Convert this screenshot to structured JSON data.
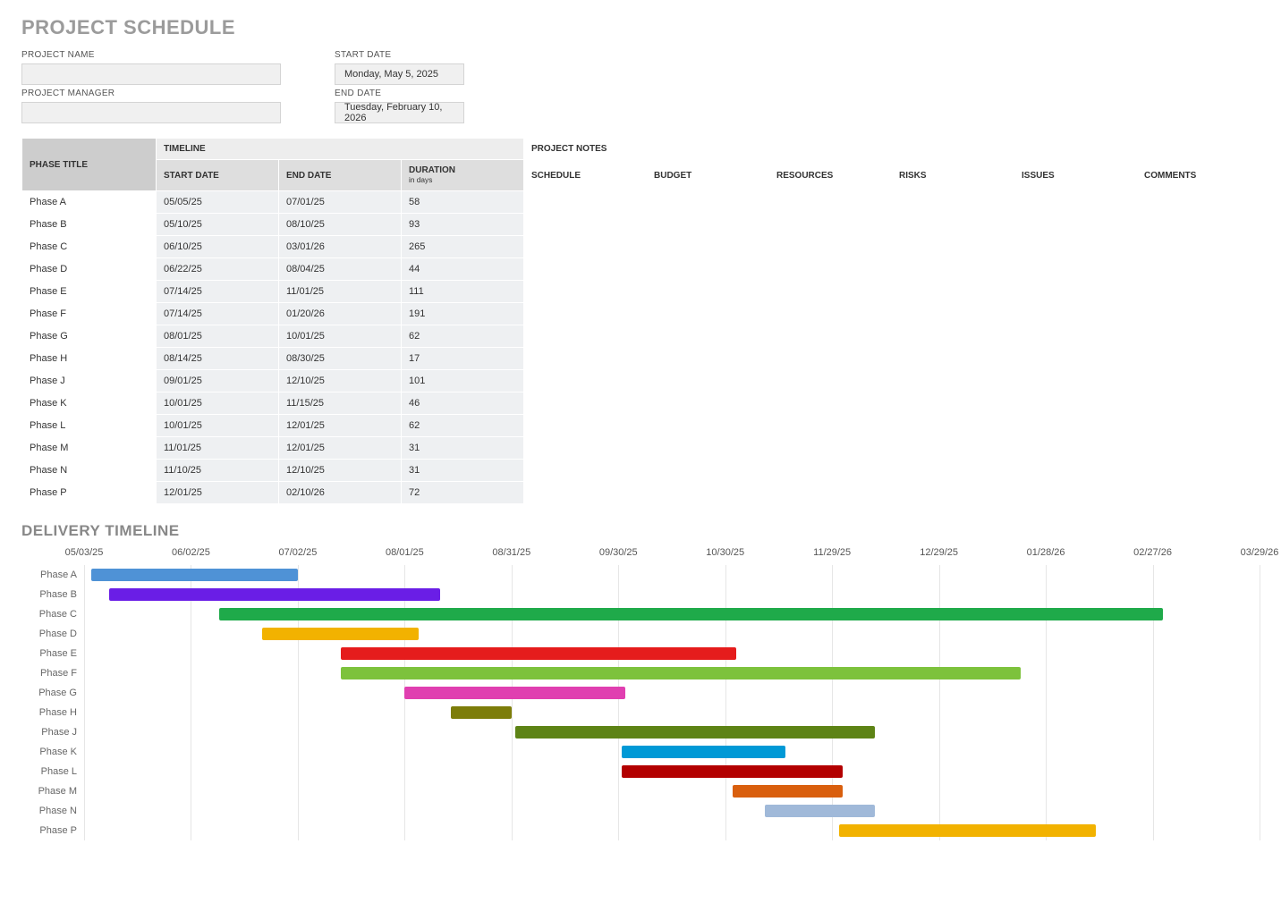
{
  "title": "PROJECT SCHEDULE",
  "header": {
    "project_name_label": "PROJECT NAME",
    "project_name_value": "",
    "project_manager_label": "PROJECT MANAGER",
    "project_manager_value": "",
    "start_date_label": "START DATE",
    "start_date_value": "Monday, May 5, 2025",
    "end_date_label": "END DATE",
    "end_date_value": "Tuesday, February 10, 2026"
  },
  "table": {
    "headers": {
      "phase_title": "PHASE TITLE",
      "timeline": "TIMELINE",
      "project_notes": "PROJECT NOTES",
      "start_date": "START DATE",
      "end_date": "END DATE",
      "duration": "DURATION",
      "duration_sub": "in days",
      "schedule": "SCHEDULE",
      "budget": "BUDGET",
      "resources": "RESOURCES",
      "risks": "RISKS",
      "issues": "ISSUES",
      "comments": "COMMENTS"
    },
    "rows": [
      {
        "title": "Phase A",
        "start": "05/05/25",
        "end": "07/01/25",
        "duration": 58,
        "schedule": "",
        "budget": "",
        "resources": "",
        "risks": "",
        "issues": "",
        "comments": ""
      },
      {
        "title": "Phase B",
        "start": "05/10/25",
        "end": "08/10/25",
        "duration": 93,
        "schedule": "",
        "budget": "",
        "resources": "",
        "risks": "",
        "issues": "",
        "comments": ""
      },
      {
        "title": "Phase C",
        "start": "06/10/25",
        "end": "03/01/26",
        "duration": 265,
        "schedule": "",
        "budget": "",
        "resources": "",
        "risks": "",
        "issues": "",
        "comments": ""
      },
      {
        "title": "Phase D",
        "start": "06/22/25",
        "end": "08/04/25",
        "duration": 44,
        "schedule": "",
        "budget": "",
        "resources": "",
        "risks": "",
        "issues": "",
        "comments": ""
      },
      {
        "title": "Phase E",
        "start": "07/14/25",
        "end": "11/01/25",
        "duration": 111,
        "schedule": "",
        "budget": "",
        "resources": "",
        "risks": "",
        "issues": "",
        "comments": ""
      },
      {
        "title": "Phase F",
        "start": "07/14/25",
        "end": "01/20/26",
        "duration": 191,
        "schedule": "",
        "budget": "",
        "resources": "",
        "risks": "",
        "issues": "",
        "comments": ""
      },
      {
        "title": "Phase G",
        "start": "08/01/25",
        "end": "10/01/25",
        "duration": 62,
        "schedule": "",
        "budget": "",
        "resources": "",
        "risks": "",
        "issues": "",
        "comments": ""
      },
      {
        "title": "Phase H",
        "start": "08/14/25",
        "end": "08/30/25",
        "duration": 17,
        "schedule": "",
        "budget": "",
        "resources": "",
        "risks": "",
        "issues": "",
        "comments": ""
      },
      {
        "title": "Phase J",
        "start": "09/01/25",
        "end": "12/10/25",
        "duration": 101,
        "schedule": "",
        "budget": "",
        "resources": "",
        "risks": "",
        "issues": "",
        "comments": ""
      },
      {
        "title": "Phase K",
        "start": "10/01/25",
        "end": "11/15/25",
        "duration": 46,
        "schedule": "",
        "budget": "",
        "resources": "",
        "risks": "",
        "issues": "",
        "comments": ""
      },
      {
        "title": "Phase L",
        "start": "10/01/25",
        "end": "12/01/25",
        "duration": 62,
        "schedule": "",
        "budget": "",
        "resources": "",
        "risks": "",
        "issues": "",
        "comments": ""
      },
      {
        "title": "Phase M",
        "start": "11/01/25",
        "end": "12/01/25",
        "duration": 31,
        "schedule": "",
        "budget": "",
        "resources": "",
        "risks": "",
        "issues": "",
        "comments": ""
      },
      {
        "title": "Phase N",
        "start": "11/10/25",
        "end": "12/10/25",
        "duration": 31,
        "schedule": "",
        "budget": "",
        "resources": "",
        "risks": "",
        "issues": "",
        "comments": ""
      },
      {
        "title": "Phase P",
        "start": "12/01/25",
        "end": "02/10/26",
        "duration": 72,
        "schedule": "",
        "budget": "",
        "resources": "",
        "risks": "",
        "issues": "",
        "comments": ""
      }
    ]
  },
  "timeline_title": "DELIVERY TIMELINE",
  "chart_data": {
    "type": "bar",
    "orientation": "horizontal-gantt",
    "x_ticks": [
      "05/03/25",
      "06/02/25",
      "07/02/25",
      "08/01/25",
      "08/31/25",
      "09/30/25",
      "10/30/25",
      "11/29/25",
      "12/29/25",
      "01/28/26",
      "02/27/26",
      "03/29/26"
    ],
    "x_range_days": {
      "start": "05/03/25",
      "span_days": 330
    },
    "series": [
      {
        "name": "Phase A",
        "start": "05/05/25",
        "duration_days": 58,
        "color": "#4f92d6"
      },
      {
        "name": "Phase B",
        "start": "05/10/25",
        "duration_days": 93,
        "color": "#6a1ee6"
      },
      {
        "name": "Phase C",
        "start": "06/10/25",
        "duration_days": 265,
        "color": "#1faa4a"
      },
      {
        "name": "Phase D",
        "start": "06/22/25",
        "duration_days": 44,
        "color": "#f2b200"
      },
      {
        "name": "Phase E",
        "start": "07/14/25",
        "duration_days": 111,
        "color": "#e51c1c"
      },
      {
        "name": "Phase F",
        "start": "07/14/25",
        "duration_days": 191,
        "color": "#7dc23c"
      },
      {
        "name": "Phase G",
        "start": "08/01/25",
        "duration_days": 62,
        "color": "#e03fb0"
      },
      {
        "name": "Phase H",
        "start": "08/14/25",
        "duration_days": 17,
        "color": "#7d7d0a"
      },
      {
        "name": "Phase J",
        "start": "09/01/25",
        "duration_days": 101,
        "color": "#5d8315"
      },
      {
        "name": "Phase K",
        "start": "10/01/25",
        "duration_days": 46,
        "color": "#0099d6"
      },
      {
        "name": "Phase L",
        "start": "10/01/25",
        "duration_days": 62,
        "color": "#b30000"
      },
      {
        "name": "Phase M",
        "start": "11/01/25",
        "duration_days": 31,
        "color": "#d95f0e"
      },
      {
        "name": "Phase N",
        "start": "11/10/25",
        "duration_days": 31,
        "color": "#a0b9d9"
      },
      {
        "name": "Phase P",
        "start": "12/01/25",
        "duration_days": 72,
        "color": "#f2b200"
      }
    ]
  }
}
